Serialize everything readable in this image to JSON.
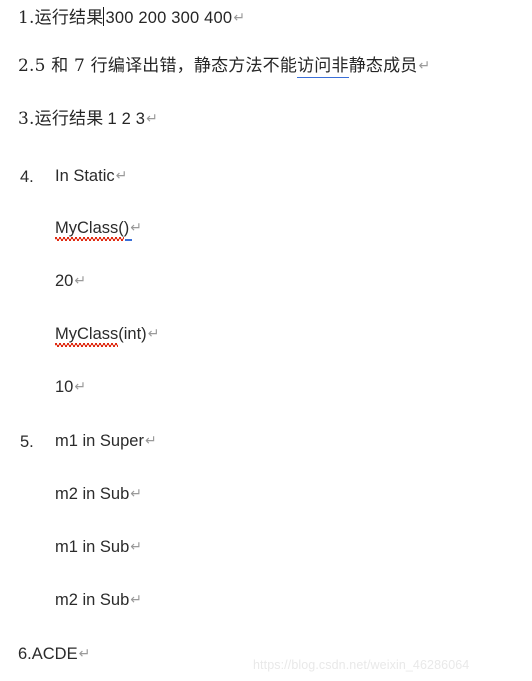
{
  "document": {
    "background_color": "#ffffff",
    "text_color": "#262626",
    "paragraph_mark": "↵",
    "accent_blue": "#3a6fd8",
    "spellcheck_red": "#e02b12",
    "watermark_color": "#e9e9e9"
  },
  "lines": {
    "l1": {
      "number": "1.",
      "cjk_label": "运行结果",
      "value": "300 200 300 400",
      "mark": "↵"
    },
    "l2": {
      "number": "2.",
      "part_a": "5 和 7 行编译出错，静态方法不能",
      "linked": "访问非",
      "part_b": "静态成员",
      "mark": "↵"
    },
    "l3": {
      "number": "3.",
      "cjk_label": "运行结果",
      "value": "1 2 3",
      "mark": "↵"
    },
    "l4": {
      "number": "4.",
      "text": "In Static",
      "mark": "↵"
    },
    "l4a": {
      "spell_text": "MyClass(",
      "tail": ")",
      "mark": "↵"
    },
    "l4b": {
      "text": "20",
      "mark": "↵"
    },
    "l4c": {
      "spell_text": "MyClass",
      "tail": "(int)",
      "mark": "↵"
    },
    "l4d": {
      "text": "10",
      "mark": "↵"
    },
    "l5": {
      "number": "5.",
      "text": "m1 in Super",
      "mark": "↵"
    },
    "l5a": {
      "text": "m2 in Sub",
      "mark": "↵"
    },
    "l5b": {
      "text": "m1 in Sub",
      "mark": "↵"
    },
    "l5c": {
      "text": "m2 in Sub",
      "mark": "↵"
    },
    "l6": {
      "number": "6.",
      "text": "ACDE",
      "mark": "↵"
    }
  },
  "watermark": {
    "text": "https://blog.csdn.net/weixin_46286064"
  }
}
